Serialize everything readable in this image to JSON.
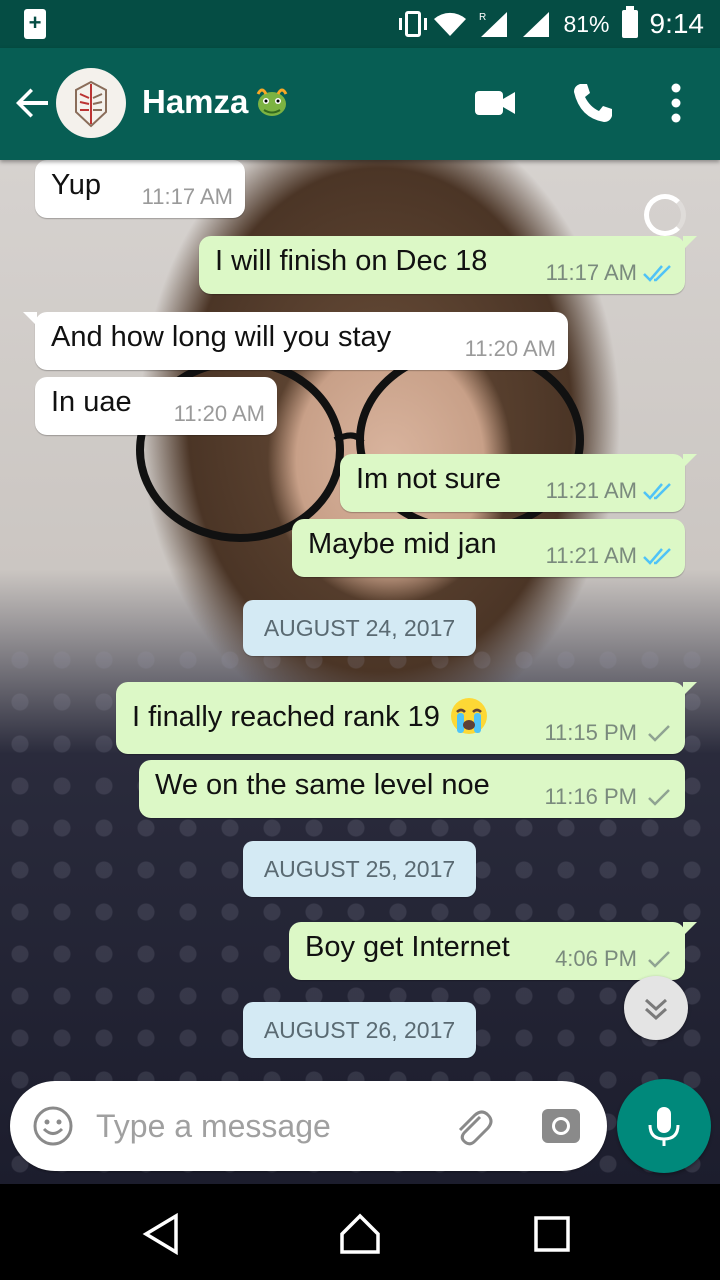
{
  "status_bar": {
    "battery_percent": "81%",
    "time": "9:14",
    "roaming_label": "R",
    "icons": [
      "battery-saver-icon",
      "vibrate-icon",
      "wifi-icon",
      "signal-roaming-icon",
      "signal-icon",
      "battery-icon"
    ]
  },
  "header": {
    "contact_name": "Hamza",
    "name_emoji": "dragon-face-emoji",
    "icons": [
      "back-arrow-icon",
      "avatar",
      "video-call-icon",
      "voice-call-icon",
      "more-vert-icon"
    ],
    "accent_color": "#075e54"
  },
  "messages": [
    {
      "dir": "in",
      "text": "Yup",
      "time": "11:17 AM"
    },
    {
      "dir": "out",
      "text": "I will finish on Dec 18",
      "time": "11:17 AM",
      "status": "read"
    },
    {
      "dir": "in",
      "text": "And how long will you stay",
      "time": "11:20 AM"
    },
    {
      "dir": "in",
      "text": "In uae",
      "time": "11:20 AM"
    },
    {
      "dir": "out",
      "text": "Im not sure",
      "time": "11:21 AM",
      "status": "read"
    },
    {
      "dir": "out",
      "text": "Maybe mid jan",
      "time": "11:21 AM",
      "status": "read"
    },
    {
      "type": "date",
      "text": "AUGUST 24, 2017"
    },
    {
      "dir": "out",
      "text": "I finally reached rank 19",
      "emoji": "loudly-crying-face-emoji",
      "time": "11:15 PM",
      "status": "sent"
    },
    {
      "dir": "out",
      "text": "We on the same level noe",
      "time": "11:16 PM",
      "status": "sent"
    },
    {
      "type": "date",
      "text": "AUGUST 25, 2017"
    },
    {
      "dir": "out",
      "text": "Boy get Internet",
      "time": "4:06 PM",
      "status": "sent"
    },
    {
      "type": "date",
      "text": "AUGUST 26, 2017"
    }
  ],
  "composer": {
    "placeholder": "Type a message",
    "icons": [
      "emoji-icon",
      "attach-icon",
      "camera-icon",
      "mic-icon"
    ]
  },
  "nav": {
    "icons": [
      "back-nav-icon",
      "home-nav-icon",
      "recents-nav-icon"
    ]
  },
  "colors": {
    "outgoing_bubble": "#dcf8c6",
    "incoming_bubble": "#ffffff",
    "read_tick": "#4fc3f7",
    "date_pill": "#d4eaf4",
    "mic_button": "#00897b"
  }
}
